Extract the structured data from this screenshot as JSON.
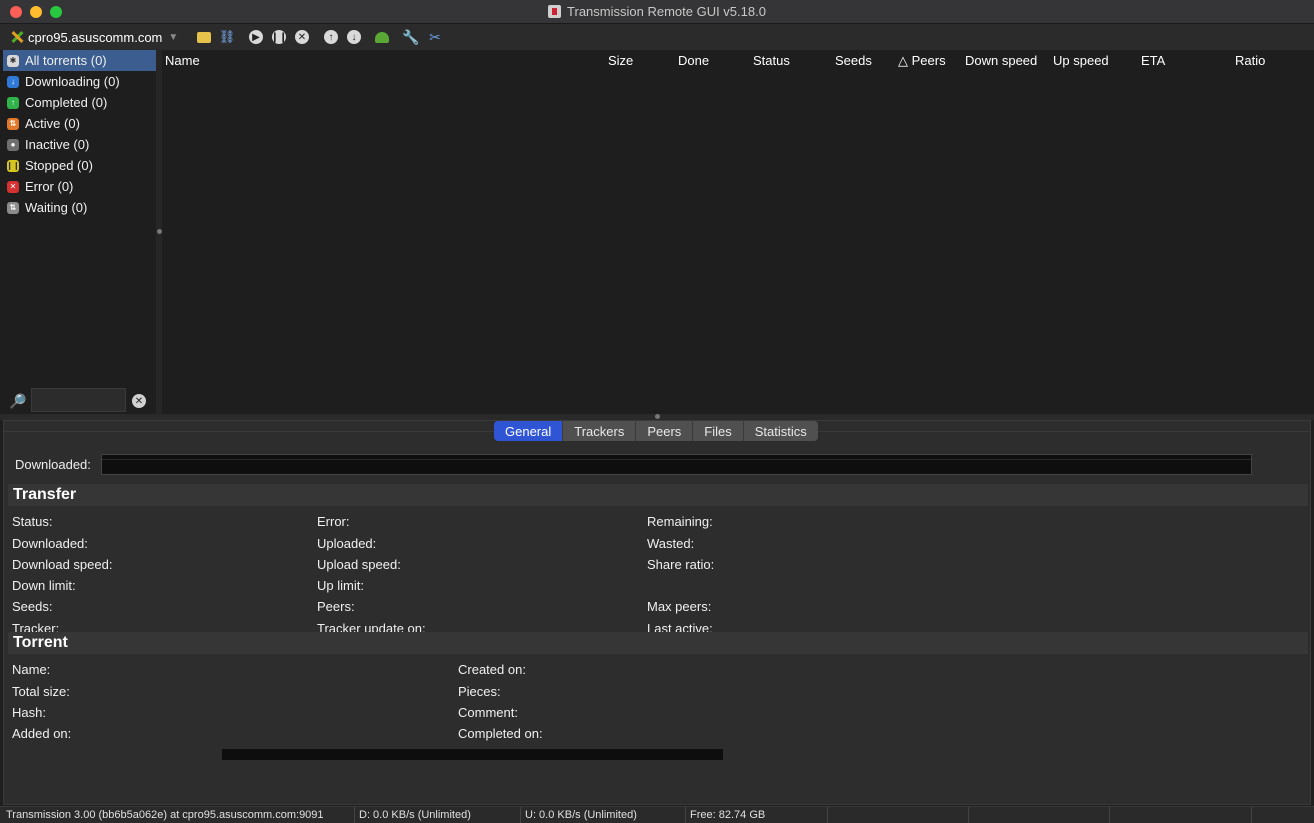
{
  "window": {
    "title": "Transmission Remote GUI v5.18.0"
  },
  "toolbar": {
    "connection": "cpro95.asuscomm.com",
    "buttons": [
      "open-folder-icon",
      "add-link-icon",
      "start-icon",
      "pause-icon",
      "remove-icon",
      "move-up-icon",
      "move-down-icon",
      "snail-icon",
      "wrench-icon",
      "tools-icon"
    ]
  },
  "sidebar": {
    "items": [
      {
        "label": "All torrents (0)",
        "icon": "all-icon",
        "color": "#d8d8d8",
        "selected": true
      },
      {
        "label": "Downloading (0)",
        "icon": "download-icon",
        "color": "#2f7ad9"
      },
      {
        "label": "Completed (0)",
        "icon": "completed-icon",
        "color": "#2fb34a"
      },
      {
        "label": "Active (0)",
        "icon": "active-icon",
        "color": "#e07a2a"
      },
      {
        "label": "Inactive (0)",
        "icon": "inactive-icon",
        "color": "#6f6f6f"
      },
      {
        "label": "Stopped (0)",
        "icon": "stopped-icon",
        "color": "#d6c61e"
      },
      {
        "label": "Error (0)",
        "icon": "error-icon",
        "color": "#d63131"
      },
      {
        "label": "Waiting (0)",
        "icon": "waiting-icon",
        "color": "#8c8c8c"
      }
    ],
    "search_value": ""
  },
  "list": {
    "columns": [
      "Name",
      "Size",
      "Done",
      "Status",
      "Seeds",
      "△ Peers",
      "Down speed",
      "Up speed",
      "ETA",
      "Ratio"
    ]
  },
  "details": {
    "tabs": [
      "General",
      "Trackers",
      "Peers",
      "Files",
      "Statistics"
    ],
    "active_tab": "General",
    "downloaded_label": "Downloaded:",
    "transfer": {
      "title": "Transfer",
      "col1": [
        "Status:",
        "Downloaded:",
        "Download speed:",
        "Down limit:",
        "Seeds:",
        "Tracker:"
      ],
      "col2": [
        "Error:",
        "Uploaded:",
        "Upload speed:",
        "Up limit:",
        "Peers:",
        "Tracker update on:"
      ],
      "col3": [
        "Remaining:",
        "Wasted:",
        "Share ratio:",
        "",
        "Max peers:",
        "Last active:"
      ]
    },
    "torrent": {
      "title": "Torrent",
      "col1": [
        "Name:",
        "Total size:",
        "Hash:",
        "Added on:"
      ],
      "col2": [
        "Created on:",
        "Pieces:",
        "Comment:",
        "Completed on:"
      ]
    }
  },
  "statusbar": {
    "version": "Transmission 3.00 (bb6b5a062e) at cpro95.asuscomm.com:9091",
    "down": "D: 0.0 KB/s (Unlimited)",
    "up": "U: 0.0 KB/s (Unlimited)",
    "free": "Free: 82.74 GB"
  }
}
